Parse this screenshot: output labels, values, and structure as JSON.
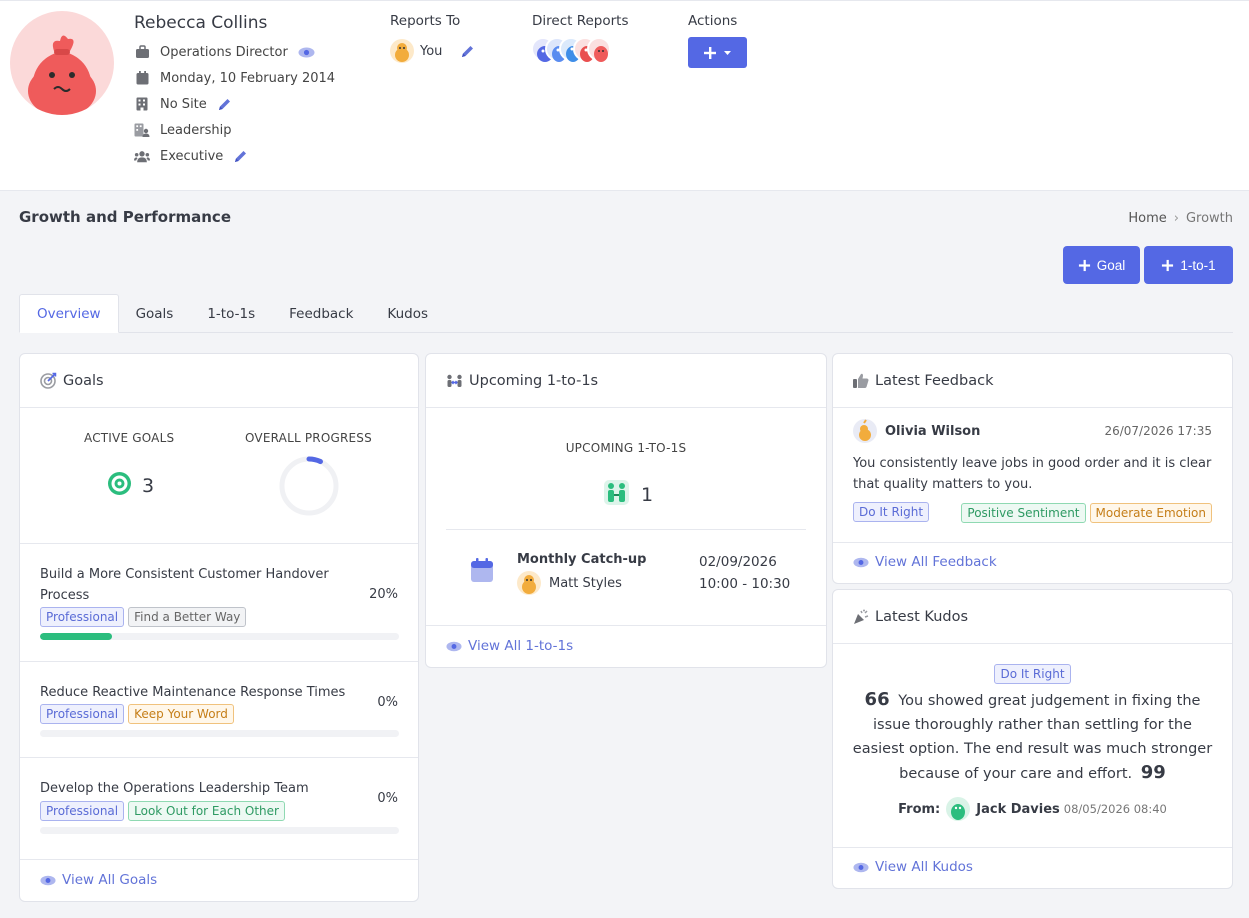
{
  "profile": {
    "name": "Rebecca Collins",
    "job_title": "Operations Director",
    "start_date": "Monday, 10 February 2014",
    "site": "No Site",
    "department": "Leadership",
    "group": "Executive",
    "reports_to_label": "Reports To",
    "reports_to_value": "You",
    "direct_reports_label": "Direct Reports",
    "actions_label": "Actions"
  },
  "page": {
    "title": "Growth and Performance",
    "breadcrumb": [
      "Home",
      "Growth"
    ],
    "add_goal_label": "Goal",
    "add_one_to_one_label": "1-to-1"
  },
  "tabs": [
    "Overview",
    "Goals",
    "1-to-1s",
    "Feedback",
    "Kudos"
  ],
  "goals_card": {
    "title": "Goals",
    "active_label": "ACTIVE GOALS",
    "active_count": "3",
    "progress_label": "OVERALL PROGRESS",
    "overall_progress": 0.07,
    "items": [
      {
        "title_line1": "Build a More Consistent Customer Handover",
        "title_line2": "Process",
        "pct": "20%",
        "progress": 0.2,
        "tags": [
          "Professional",
          "Find a Better Way"
        ]
      },
      {
        "title_line1": "Reduce Reactive Maintenance Response Times",
        "title_line2": "",
        "pct": "0%",
        "progress": 0,
        "tags": [
          "Professional",
          "Keep Your Word"
        ]
      },
      {
        "title_line1": "Develop the Operations Leadership Team",
        "title_line2": "",
        "pct": "0%",
        "progress": 0,
        "tags": [
          "Professional",
          "Look Out for Each Other"
        ]
      }
    ],
    "view_all": "View All Goals"
  },
  "one_to_ones_card": {
    "title": "Upcoming 1-to-1s",
    "upcoming_label": "UPCOMING 1-TO-1S",
    "upcoming_count": "1",
    "meeting": {
      "name": "Monthly Catch-up",
      "with": "Matt Styles",
      "date": "02/09/2026",
      "time": "10:00 - 10:30"
    },
    "view_all": "View All 1-to-1s"
  },
  "feedback_card": {
    "title": "Latest Feedback",
    "author": "Olivia Wilson",
    "timestamp": "26/07/2026 17:35",
    "text_line1": "You consistently leave jobs in good order and it is clear",
    "text_line2": "that quality matters to you.",
    "value_tag": "Do It Right",
    "sentiment_tag": "Positive Sentiment",
    "emotion_tag": "Moderate Emotion",
    "view_all": "View All Feedback"
  },
  "kudos_card": {
    "title": "Latest Kudos",
    "value_tag": "Do It Right",
    "quote_open": "66",
    "quote_close": "99",
    "text_line1": "You showed great judgement in fixing the",
    "text_line2": "issue thoroughly rather than settling for the",
    "text_line3": "easiest option. The end result was much stronger",
    "text_line4": "because of your care and effort.",
    "from_label": "From:",
    "author": "Jack Davies",
    "timestamp": "08/05/2026 08:40",
    "view_all": "View All Kudos"
  },
  "colors": {
    "accent": "#5468e4",
    "progress_green": "#2bbd7e",
    "link": "#6273d8"
  }
}
